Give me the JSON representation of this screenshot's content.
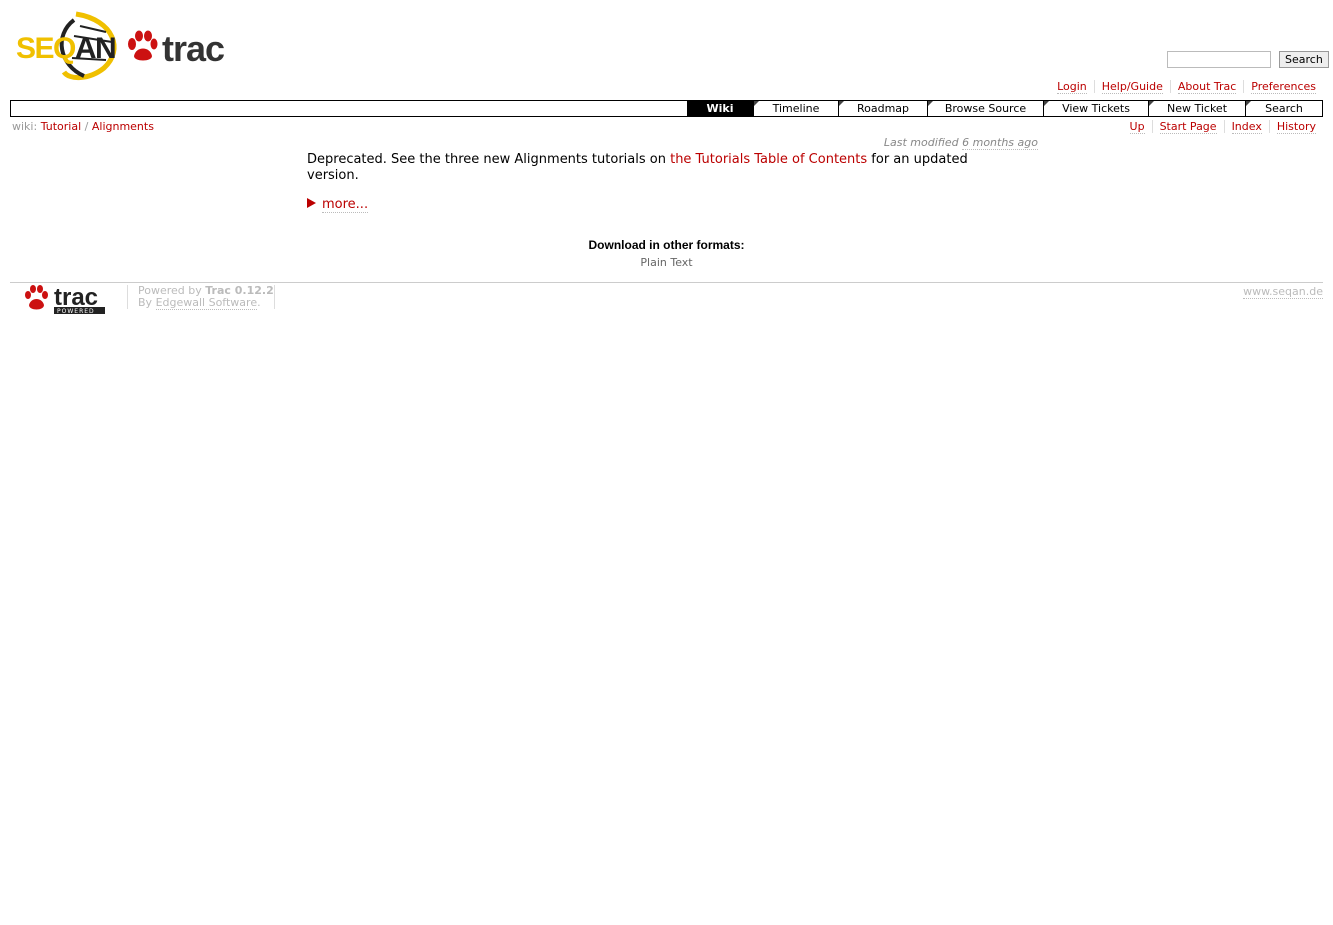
{
  "logo": {
    "seqan_text": "SEQ",
    "seqan_text_2": "AN",
    "trac_text": "trac"
  },
  "search": {
    "placeholder": "",
    "button_label": "Search"
  },
  "metanav": [
    "Login",
    "Help/Guide",
    "About Trac",
    "Preferences"
  ],
  "mainnav": [
    {
      "label": "Wiki",
      "active": true
    },
    {
      "label": "Timeline"
    },
    {
      "label": "Roadmap"
    },
    {
      "label": "Browse Source"
    },
    {
      "label": "View Tickets"
    },
    {
      "label": "New Ticket"
    },
    {
      "label": "Search"
    }
  ],
  "breadcrumb": {
    "prefix": "wiki:",
    "items": [
      "Tutorial",
      "Alignments"
    ],
    "separator": "/"
  },
  "ctxtnav": [
    "Up",
    "Start Page",
    "Index",
    "History"
  ],
  "lastmod": {
    "prefix": "Last modified ",
    "age": "6 months ago"
  },
  "content": {
    "text_before": "Deprecated. See the three new Alignments tutorials on ",
    "link": "the Tutorials Table of Contents",
    "text_after": " for an updated version.",
    "more": "more..."
  },
  "altlinks": {
    "heading": "Download in other formats:",
    "formats": [
      "Plain Text"
    ]
  },
  "footer": {
    "logo_text": "trac",
    "logo_sub": "POWERED",
    "powered_by": "Powered by ",
    "trac_version": "Trac 0.12.2",
    "by": "By ",
    "edgewall": "Edgewall Software",
    "period": ".",
    "site": "www.seqan.de"
  },
  "colors": {
    "link": "#bb0000",
    "seqan_yellow": "#f0c000",
    "paw_red": "#cc1111"
  }
}
